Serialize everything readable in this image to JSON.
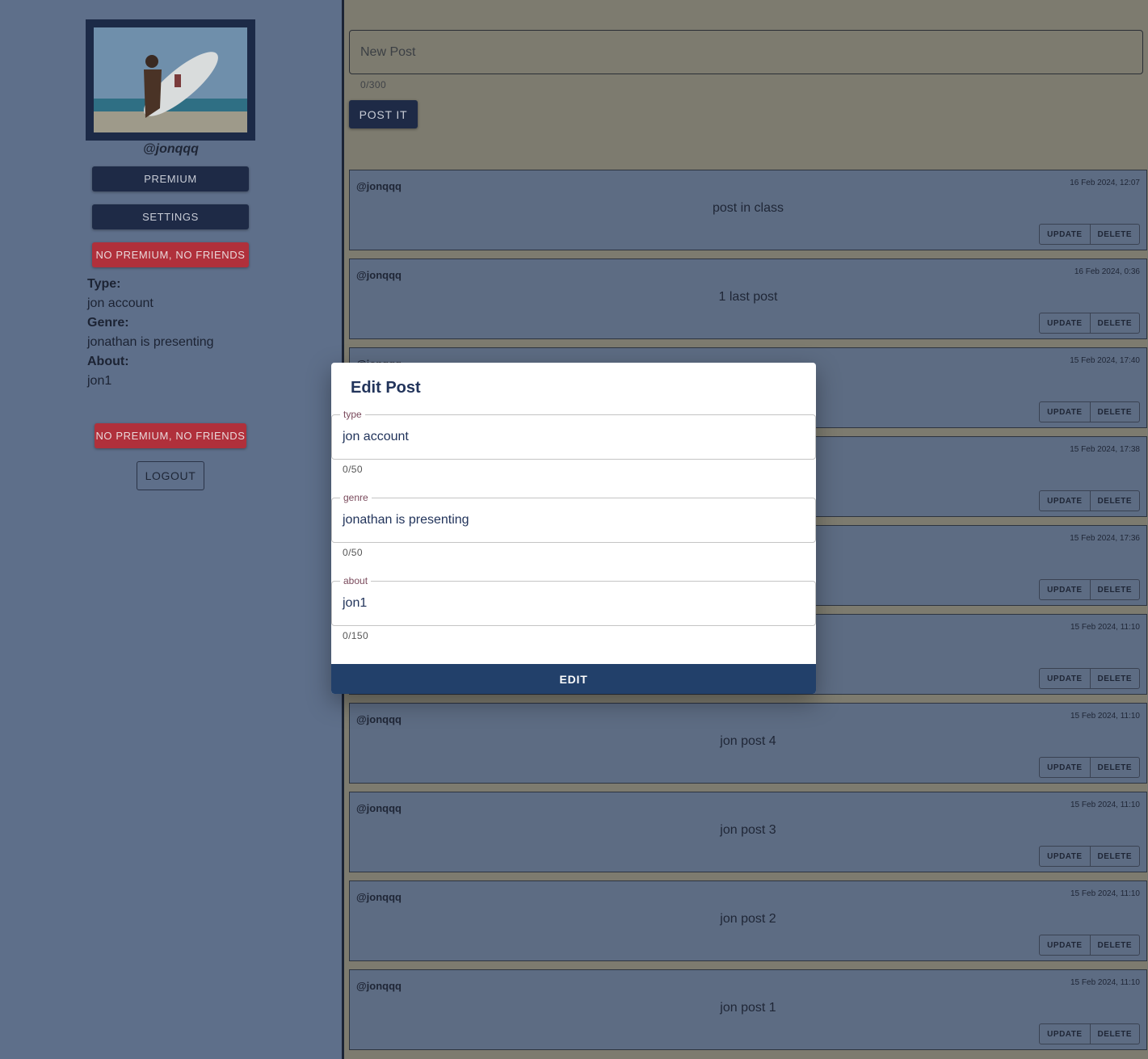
{
  "profile": {
    "username": "@jonqqq",
    "premium_label": "PREMIUM",
    "settings_label": "SETTINGS",
    "no_premium_label": "NO PREMIUM, NO FRIENDS",
    "type_label": "Type:",
    "type_value": "jon account",
    "genre_label": "Genre:",
    "genre_value": "jonathan is presenting",
    "about_label": "About:",
    "about_value": "jon1",
    "no_premium_label_2": "NO PREMIUM, NO FRIENDS",
    "logout_label": "LOGOUT"
  },
  "composer": {
    "placeholder": "New Post",
    "counter": "0/300",
    "post_button": "POST IT"
  },
  "posts": [
    {
      "user": "@jonqqq",
      "date": "16 Feb 2024, 12:07",
      "text": "post in class",
      "update": "UPDATE",
      "delete": "DELETE"
    },
    {
      "user": "@jonqqq",
      "date": "16 Feb 2024, 0:36",
      "text": "1 last post",
      "update": "UPDATE",
      "delete": "DELETE"
    },
    {
      "user": "@jonqqq",
      "date": "15 Feb 2024, 17:40",
      "text": "",
      "update": "UPDATE",
      "delete": "DELETE"
    },
    {
      "user": "",
      "date": "15 Feb 2024, 17:38",
      "text": "",
      "update": "UPDATE",
      "delete": "DELETE"
    },
    {
      "user": "",
      "date": "15 Feb 2024, 17:36",
      "text": "",
      "update": "UPDATE",
      "delete": "DELETE"
    },
    {
      "user": "",
      "date": "15 Feb 2024, 11:10",
      "text": "",
      "update": "UPDATE",
      "delete": "DELETE"
    },
    {
      "user": "@jonqqq",
      "date": "15 Feb 2024, 11:10",
      "text": "jon post 4",
      "update": "UPDATE",
      "delete": "DELETE"
    },
    {
      "user": "@jonqqq",
      "date": "15 Feb 2024, 11:10",
      "text": "jon post 3",
      "update": "UPDATE",
      "delete": "DELETE"
    },
    {
      "user": "@jonqqq",
      "date": "15 Feb 2024, 11:10",
      "text": "jon post 2",
      "update": "UPDATE",
      "delete": "DELETE"
    },
    {
      "user": "@jonqqq",
      "date": "15 Feb 2024, 11:10",
      "text": "jon post 1",
      "update": "UPDATE",
      "delete": "DELETE"
    }
  ],
  "modal": {
    "title": "Edit Post",
    "fields": [
      {
        "label": "type",
        "value": "jon account",
        "counter": "0/50"
      },
      {
        "label": "genre",
        "value": "jonathan is presenting",
        "counter": "0/50"
      },
      {
        "label": "about",
        "value": "jon1",
        "counter": "0/150"
      }
    ],
    "edit_button": "EDIT"
  },
  "colors": {
    "primary": "#22406a",
    "danger": "#b0303b",
    "sidebar": "#5e6f8a",
    "backdrop_main": "#7d7b6f"
  }
}
